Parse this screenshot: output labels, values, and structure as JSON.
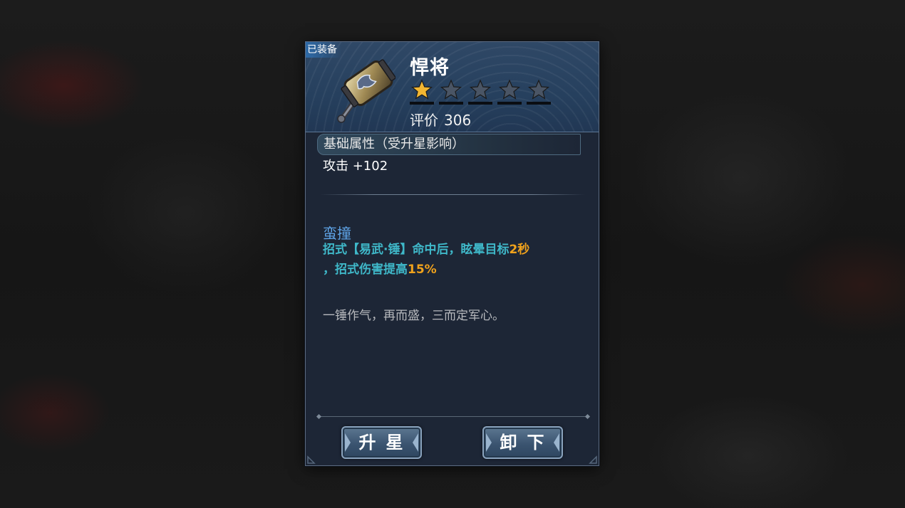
{
  "item": {
    "equipped_tag": "已装备",
    "name": "悍将",
    "stars_filled": 1,
    "stars_total": 5,
    "rating_label": "评价",
    "rating_value": "306",
    "icon": "hammer-icon"
  },
  "base_attributes": {
    "title": "基础属性（受升星影响）",
    "stat": "攻击 +102"
  },
  "skill": {
    "name": "蛮撞",
    "desc_part1": "招式【易武·锤】命中后，眩晕目标",
    "desc_hl1": "2秒",
    "desc_part2": "，招式伤害提高",
    "desc_hl2": "15%"
  },
  "flavor_text": "一锤作气，再而盛，三而定军心。",
  "buttons": {
    "upgrade_label": "升星",
    "unequip_label": "卸下"
  },
  "colors": {
    "star_filled": "#f2b632",
    "star_empty": "#4a5565",
    "skill_name": "#5ea3e6",
    "skill_desc": "#3fb8c9",
    "highlight": "#f0a21c"
  }
}
